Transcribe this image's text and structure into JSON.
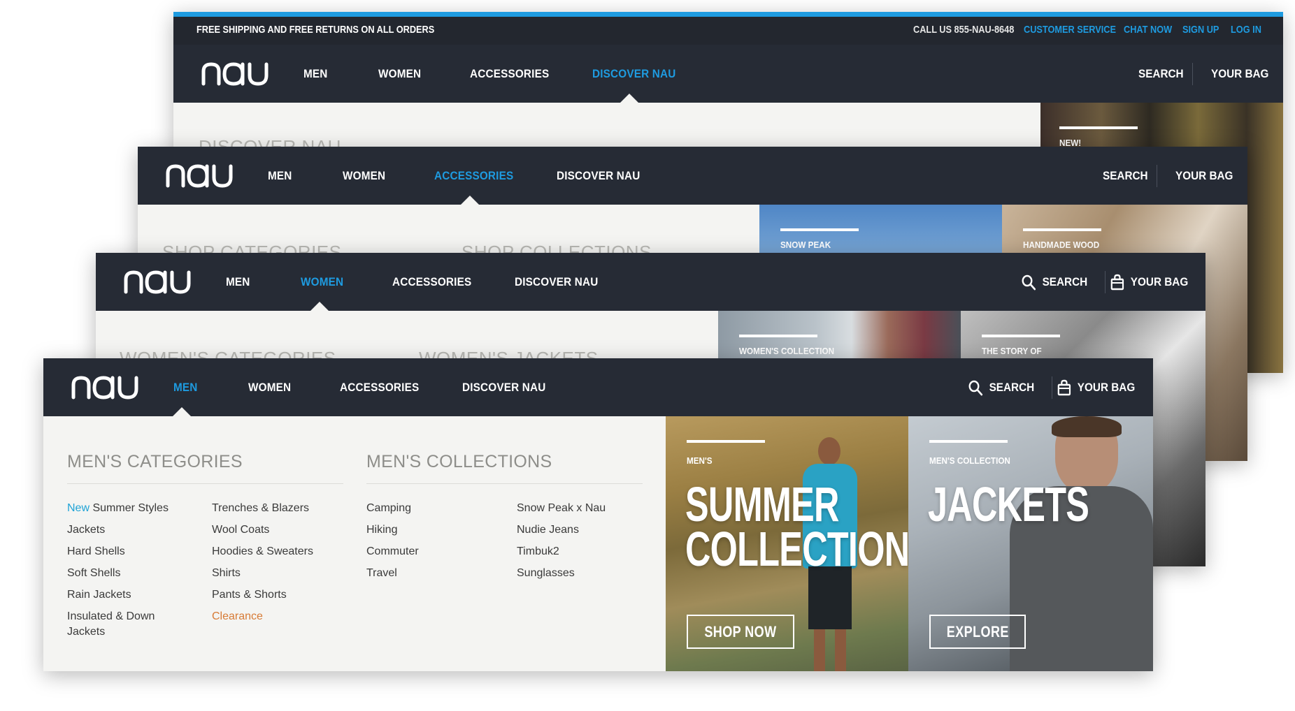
{
  "brand": {
    "logo_text": "nau",
    "accent": "#1e9be0",
    "nav_bg": "#262b35",
    "clearance_color": "#d77b36",
    "new_color": "#1fa3d6"
  },
  "top_bar": {
    "shipping": "FREE SHIPPING AND FREE RETURNS ON ALL ORDERS",
    "phone": "CALL US 855-NAU-8648",
    "links": [
      "CUSTOMER SERVICE",
      "CHAT NOW",
      "SIGN UP",
      "LOG IN"
    ]
  },
  "nav": {
    "men": "MEN",
    "women": "WOMEN",
    "accessories": "ACCESSORIES",
    "discover": "DISCOVER NAU",
    "search": "SEARCH",
    "bag": "YOUR BAG"
  },
  "layers": {
    "discover": {
      "heading": "DISCOVER NAU",
      "promo_label": "NEW!"
    },
    "accessories": {
      "heading_left": "SHOP CATEGORIES",
      "heading_right": "SHOP COLLECTIONS",
      "promo1_label": "SNOW PEAK",
      "promo2_label": "HANDMADE WOOD"
    },
    "women": {
      "heading_left": "WOMEN'S CATEGORIES",
      "heading_right": "WOMEN'S JACKETS",
      "promo1_label": "WOMEN'S COLLECTION",
      "promo2_label": "THE STORY OF"
    }
  },
  "men_menu": {
    "categories_title": "MEN'S CATEGORIES",
    "collections_title": "MEN'S COLLECTIONS",
    "new_tag": "New",
    "categories_col1": [
      "Summer Styles",
      "Jackets",
      "Hard Shells",
      "Soft Shells",
      "Rain Jackets",
      "Insulated & Down",
      "Jackets"
    ],
    "categories_col2": [
      "Trenches & Blazers",
      "Wool Coats",
      "Hoodies & Sweaters",
      "Shirts",
      "Pants & Shorts",
      "Clearance"
    ],
    "collections_col1": [
      "Camping",
      "Hiking",
      "Commuter",
      "Travel"
    ],
    "collections_col2": [
      "Snow Peak x Nau",
      "Nudie Jeans",
      "Timbuk2",
      "Sunglasses"
    ],
    "promo_summer": {
      "label": "MEN'S",
      "title_line1": "SUMMER",
      "title_line2": "COLLECTION",
      "cta": "SHOP NOW"
    },
    "promo_jackets": {
      "label": "MEN'S COLLECTION",
      "title": "JACKETS",
      "cta": "EXPLORE"
    }
  }
}
